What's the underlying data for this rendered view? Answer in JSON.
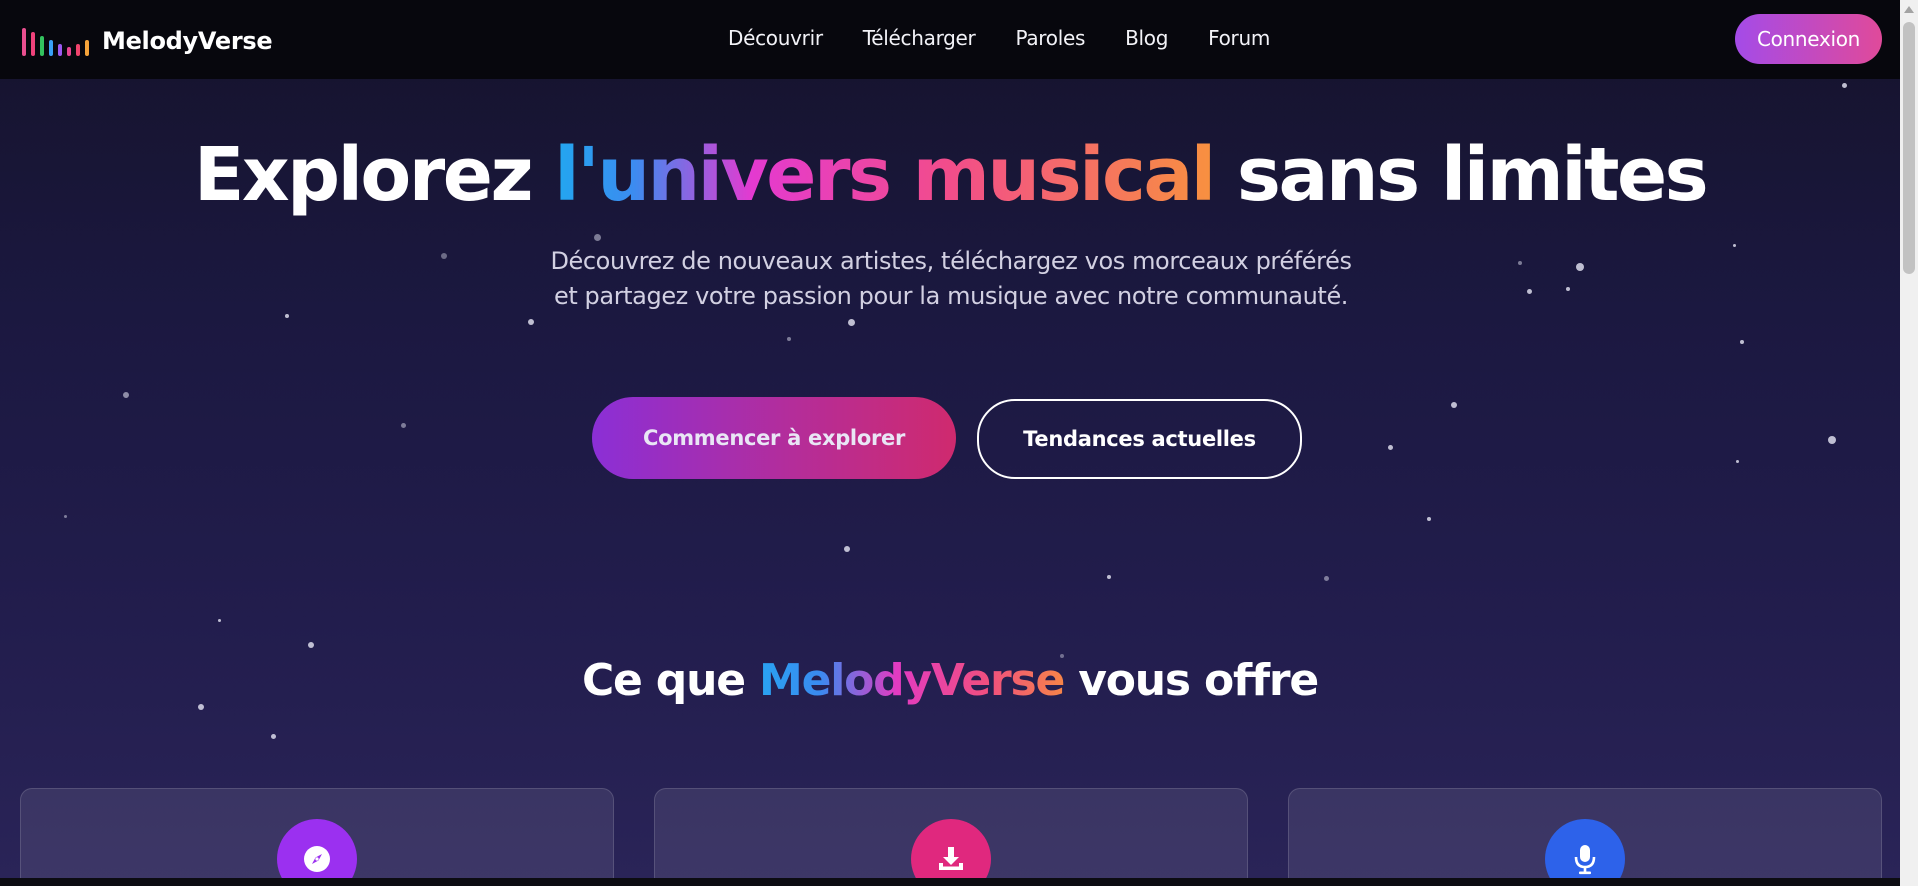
{
  "nav": {
    "brand": "MelodyVerse",
    "links": [
      "Découvrir",
      "Télécharger",
      "Paroles",
      "Blog",
      "Forum"
    ],
    "login": "Connexion"
  },
  "hero": {
    "title_start": "Explorez ",
    "title_highlight": "l'univers musical",
    "title_end": " sans limites",
    "subtitle": "Découvrez de nouveaux artistes, téléchargez vos morceaux préférés et partagez votre passion pour la musique avec notre communauté.",
    "primary_button": "Commencer à explorer",
    "secondary_button": "Tendances actuelles"
  },
  "features": {
    "title_start": "Ce que ",
    "title_highlight": "MelodyVerse",
    "title_end": " vous offre",
    "cards": [
      {
        "icon": "compass-icon",
        "color": "#9b30f0"
      },
      {
        "icon": "download-icon",
        "color": "#e0287e"
      },
      {
        "icon": "microphone-icon",
        "color": "#2d62ea"
      }
    ]
  },
  "colors": {
    "brand_purple": "#a44be8",
    "brand_pink": "#e04a9a",
    "navbar": "#07070d"
  }
}
